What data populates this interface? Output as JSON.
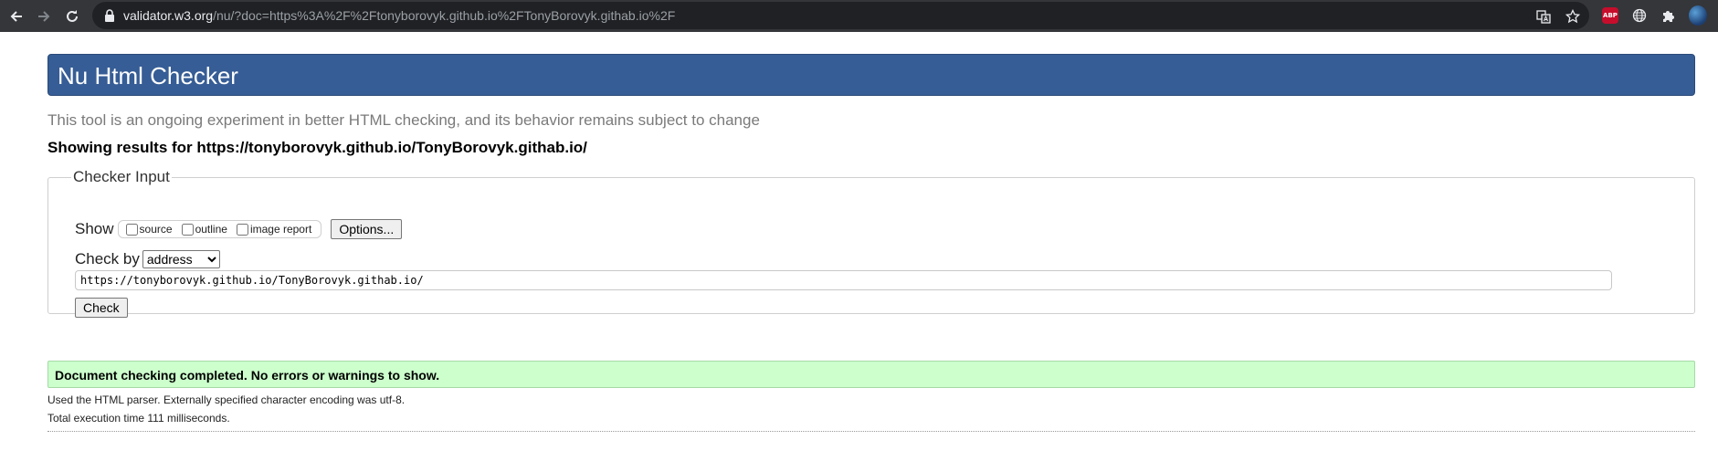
{
  "browser": {
    "url_host": "validator.w3.org",
    "url_rest": "/nu/?doc=https%3A%2F%2Ftonyborovyk.github.io%2FTonyBorovyk.githab.io%2F",
    "extensions": [
      "translate-icon",
      "star-icon",
      "adblock-plus-icon",
      "globe-icon",
      "puzzle-icon",
      "avatar"
    ],
    "abp_label": "ABP"
  },
  "page": {
    "title": "Nu Html Checker",
    "intro": "This tool is an ongoing experiment in better HTML checking, and its behavior remains subject to change",
    "showing_results": "Showing results for https://tonyborovyk.github.io/TonyBorovyk.githab.io/"
  },
  "checker_input": {
    "legend": "Checker Input",
    "show_label": "Show",
    "show_options": [
      {
        "label": "source",
        "checked": false
      },
      {
        "label": "outline",
        "checked": false
      },
      {
        "label": "image report",
        "checked": false
      }
    ],
    "options_button": "Options...",
    "check_by_label": "Check by",
    "check_by_value": "address",
    "document_url": "https://tonyborovyk.github.io/TonyBorovyk.githab.io/",
    "check_button": "Check"
  },
  "results": {
    "success_message": "Document checking completed. No errors or warnings to show.",
    "parser_info": "Used the HTML parser. Externally specified character encoding was utf-8.",
    "execution_time": "Total execution time 111 milliseconds."
  },
  "colors": {
    "header_bg": "#365d95",
    "success_bg": "#ccffcc",
    "chrome_bg": "#35363a"
  }
}
